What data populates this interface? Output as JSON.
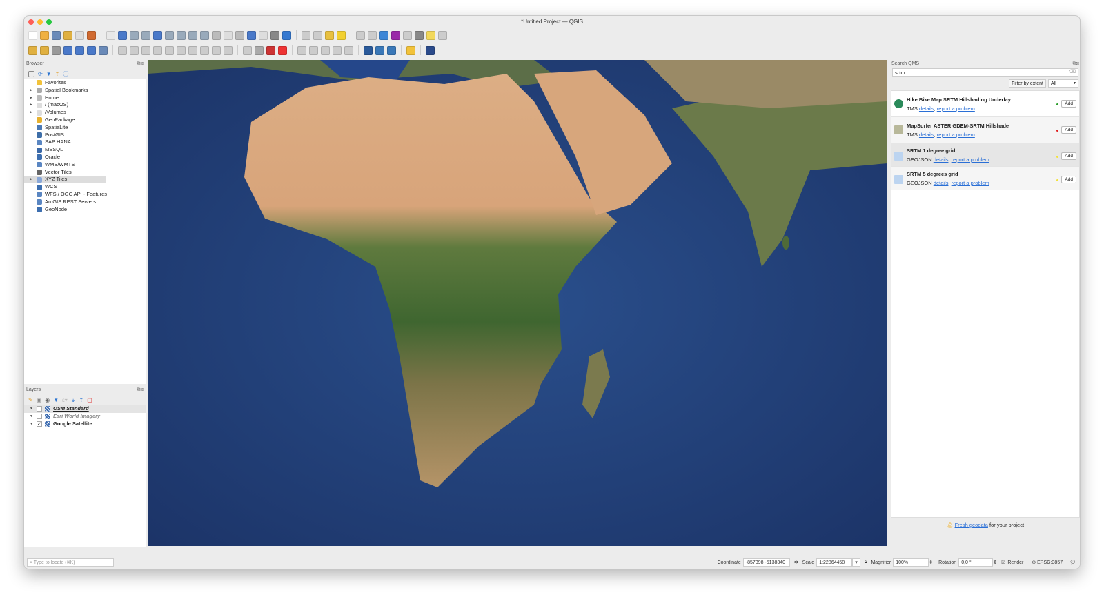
{
  "window": {
    "title": "*Untitled Project — QGIS"
  },
  "browser": {
    "title": "Browser",
    "items": [
      {
        "label": "Favorites",
        "icon": "star-icon",
        "expandable": false,
        "color": "#f2c23a"
      },
      {
        "label": "Spatial Bookmarks",
        "icon": "bookmark-icon",
        "expandable": true,
        "color": "#aaa"
      },
      {
        "label": "Home",
        "icon": "home-icon",
        "expandable": true,
        "color": "#bbb"
      },
      {
        "label": "/ (macOS)",
        "icon": "folder-icon",
        "expandable": true,
        "color": "#ddd"
      },
      {
        "label": "/Volumes",
        "icon": "folder-icon",
        "expandable": true,
        "color": "#ddd"
      },
      {
        "label": "GeoPackage",
        "icon": "geopackage-icon",
        "expandable": false,
        "color": "#e7b12d"
      },
      {
        "label": "SpatiaLite",
        "icon": "feather-icon",
        "expandable": false,
        "color": "#4a79b5"
      },
      {
        "label": "PostGIS",
        "icon": "elephant-icon",
        "expandable": false,
        "color": "#3d6ea8"
      },
      {
        "label": "SAP HANA",
        "icon": "chip-icon",
        "expandable": false,
        "color": "#5a86c2"
      },
      {
        "label": "MSSQL",
        "icon": "mssql-icon",
        "expandable": false,
        "color": "#3b69a8"
      },
      {
        "label": "Oracle",
        "icon": "oracle-icon",
        "expandable": false,
        "color": "#3d6fb0"
      },
      {
        "label": "WMS/WMTS",
        "icon": "globe-icon",
        "expandable": false,
        "color": "#5a86c2"
      },
      {
        "label": "Vector Tiles",
        "icon": "grid-icon",
        "expandable": false,
        "color": "#666"
      },
      {
        "label": "XYZ Tiles",
        "icon": "tiles-icon",
        "expandable": true,
        "color": "#8aa8d8"
      },
      {
        "label": "WCS",
        "icon": "globe-icon",
        "expandable": false,
        "color": "#3d6fb0"
      },
      {
        "label": "WFS / OGC API - Features",
        "icon": "globe-icon",
        "expandable": false,
        "color": "#5a86c2"
      },
      {
        "label": "ArcGIS REST Servers",
        "icon": "globe-icon",
        "expandable": false,
        "color": "#5a86c2"
      },
      {
        "label": "GeoNode",
        "icon": "geonode-icon",
        "expandable": false,
        "color": "#3d6fb0"
      }
    ]
  },
  "layers": {
    "title": "Layers",
    "items": [
      {
        "label": "OSM Standard",
        "checked": false,
        "style": "bold-italic-underline"
      },
      {
        "label": "Esri World Imagery",
        "checked": false,
        "style": "italic-gray"
      },
      {
        "label": "Google Satellite",
        "checked": true,
        "style": "bold"
      }
    ]
  },
  "qms": {
    "title": "Search QMS",
    "query": "srtm",
    "filter_button": "Filter by extent",
    "filter_select": "All",
    "results": [
      {
        "name": "Hike Bike Map SRTM Hillshading Underlay",
        "type": "TMS",
        "details": "details",
        "report": "report a problem",
        "status_color": "#2a9d2a",
        "add": "Add"
      },
      {
        "name": "MapSurfer ASTER GDEM-SRTM Hillshade",
        "type": "TMS",
        "details": "details",
        "report": "report a problem",
        "status_color": "#e02020",
        "add": "Add"
      },
      {
        "name": "SRTM 1 degree grid",
        "type": "GEOJSON",
        "details": "details",
        "report": "report a problem",
        "status_color": "#f2e23a",
        "add": "Add"
      },
      {
        "name": "SRTM 5 degrees grid",
        "type": "GEOJSON",
        "details": "details",
        "report": "report a problem",
        "status_color": "#f2e23a",
        "add": "Add"
      }
    ],
    "footer_link": "Fresh geodata",
    "footer_text": "for your project"
  },
  "status": {
    "locate_placeholder": "Type to locate (⌘K)",
    "coordinate_label": "Coordinate",
    "coordinate": "-857398 -5138340",
    "scale_label": "Scale",
    "scale": "1:22864458",
    "magnifier_label": "Magnifier",
    "magnifier": "100%",
    "rotation_label": "Rotation",
    "rotation": "0,0 °",
    "render_label": "Render",
    "render_checked": true,
    "crs": "EPSG:3857"
  }
}
